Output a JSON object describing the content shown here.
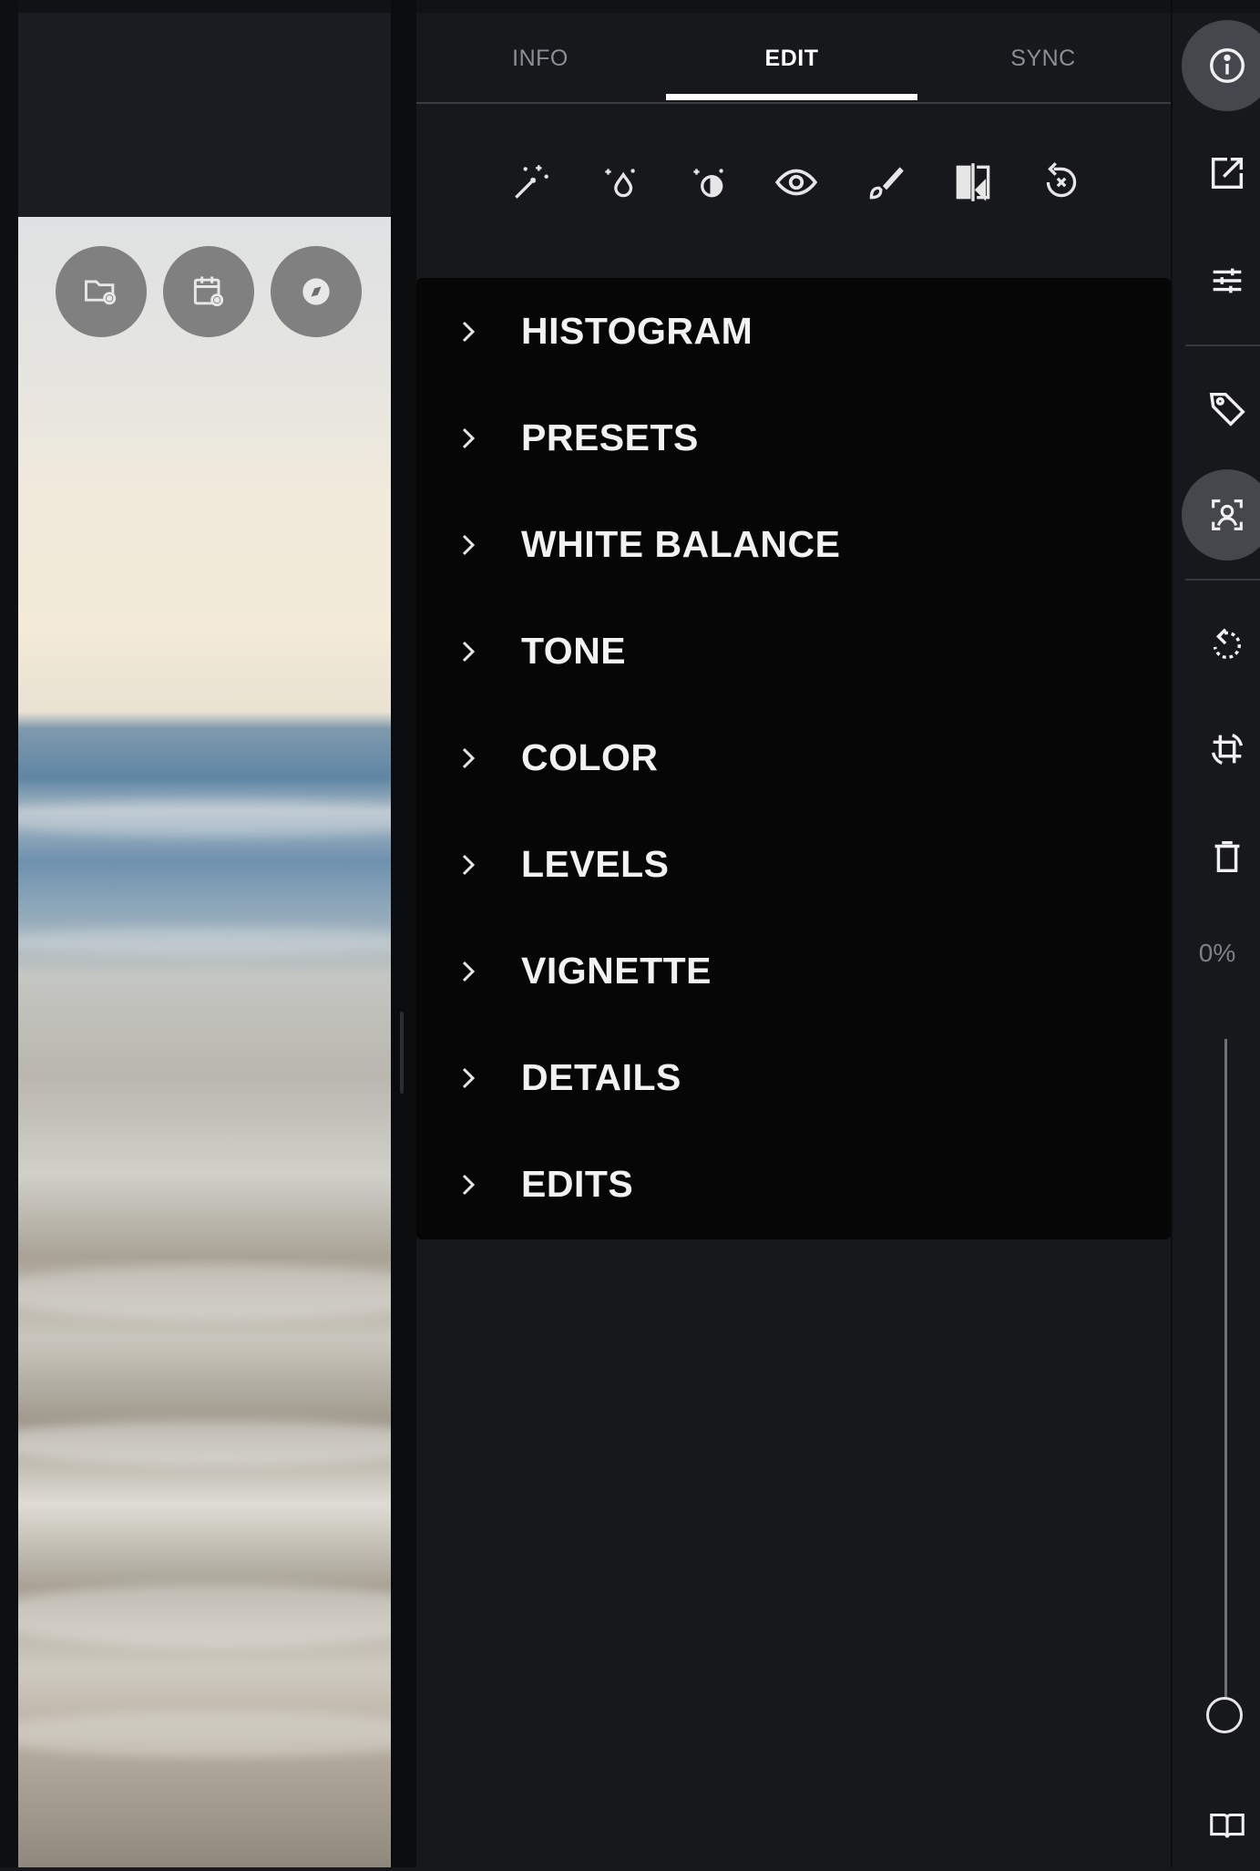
{
  "tabs": [
    {
      "label": "INFO",
      "active": false
    },
    {
      "label": "EDIT",
      "active": true
    },
    {
      "label": "SYNC",
      "active": false
    }
  ],
  "tools": [
    {
      "icon": "magic-wand-icon"
    },
    {
      "icon": "sparkle-drop-icon"
    },
    {
      "icon": "sparkle-contrast-icon"
    },
    {
      "icon": "eye-icon"
    },
    {
      "icon": "brush-icon"
    },
    {
      "icon": "compare-icon"
    },
    {
      "icon": "reset-icon"
    }
  ],
  "sections": [
    {
      "label": "HISTOGRAM"
    },
    {
      "label": "PRESETS"
    },
    {
      "label": "WHITE BALANCE"
    },
    {
      "label": "TONE"
    },
    {
      "label": "COLOR"
    },
    {
      "label": "LEVELS"
    },
    {
      "label": "VIGNETTE"
    },
    {
      "label": "DETAILS"
    },
    {
      "label": "EDITS"
    }
  ],
  "photo_buttons": [
    {
      "icon": "folder-view-icon"
    },
    {
      "icon": "calendar-view-icon"
    },
    {
      "icon": "compass-icon"
    }
  ],
  "rail": {
    "buttons": [
      {
        "icon": "info-icon",
        "selected": true
      },
      {
        "icon": "open-external-icon",
        "selected": false
      },
      {
        "icon": "sliders-icon",
        "selected": false
      },
      {
        "icon": "tag-icon",
        "selected": false
      },
      {
        "icon": "face-icon",
        "selected": true
      },
      {
        "icon": "rotate-icon",
        "selected": false
      },
      {
        "icon": "crop-rotate-icon",
        "selected": false
      },
      {
        "icon": "trash-icon",
        "selected": false
      },
      {
        "icon": "book-icon",
        "selected": false
      }
    ],
    "zoom_label": "0%",
    "zoom_level": 0
  },
  "colors": {
    "background": "#17181c",
    "sections_background": "#060606",
    "rail_selected": "#45474d",
    "tab_inactive": "#8b8e95"
  }
}
